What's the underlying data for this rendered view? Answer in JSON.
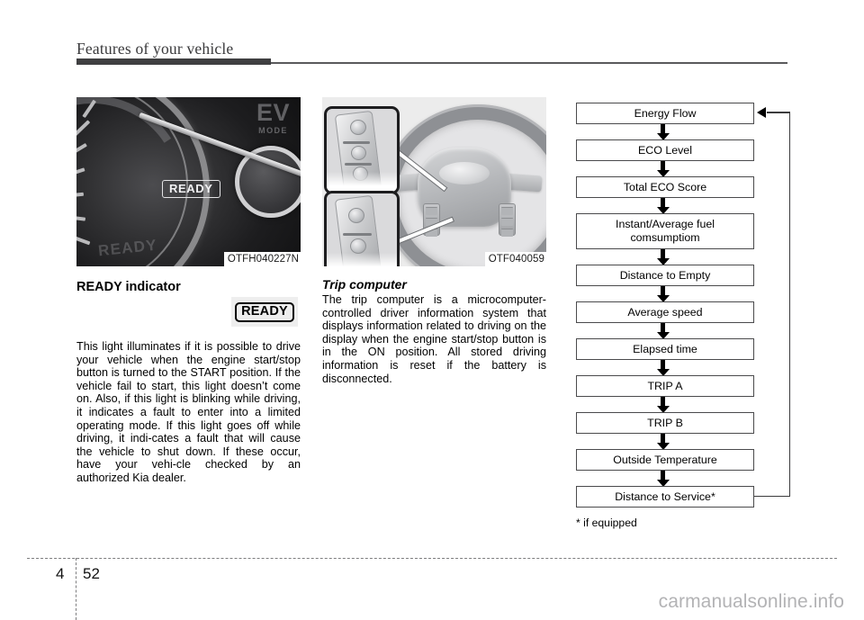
{
  "header": {
    "title": "Features of your vehicle"
  },
  "figures": {
    "cluster": {
      "caption": "OTFH040227N",
      "ready_text": "READY",
      "ev_text": "EV",
      "mode_text": "MODE",
      "ghost_text": "READY"
    },
    "steering": {
      "caption": "OTF040059"
    }
  },
  "left_column": {
    "heading": "READY indicator",
    "badge_label": "READY",
    "paragraph": "This light illuminates if it is possible to drive your vehicle when the engine start/stop button is turned to the START position. If the vehicle fail to start, this light doesn’t come on. Also, if this light is blinking while driving, it indicates a fault to enter into a limited operating mode. If this light goes off while driving, it indi-cates a fault that will cause the vehicle to shut down. If these occur, have your vehi-cle checked by an authorized Kia dealer."
  },
  "middle_column": {
    "heading": "Trip computer",
    "paragraph": "The trip computer is a microcomputer-controlled driver information system that displays information related to driving on the display when the engine start/stop button is in the ON position. All stored driving information is reset if the battery is disconnected."
  },
  "flowchart": {
    "steps": [
      "Energy Flow",
      "ECO Level",
      "Total ECO Score",
      "Instant/Average fuel comsumptiom",
      "Distance to Empty",
      "Average speed",
      "Elapsed time",
      "TRIP A",
      "TRIP B",
      "Outside Temperature",
      "Distance to Service*"
    ],
    "footnote": "* if equipped"
  },
  "footer": {
    "chapter": "4",
    "page": "52",
    "watermark": "carmanualsonline.info"
  }
}
